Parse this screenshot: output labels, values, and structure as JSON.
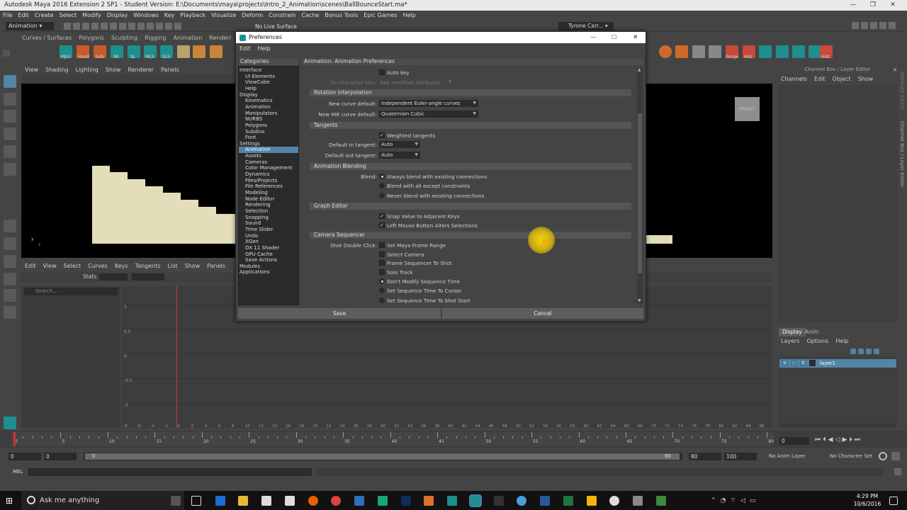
{
  "window": {
    "title": "Autodesk Maya 2016 Extension 2 SP1 - Student Version: E:\\Documents\\maya\\projects\\Intro_2_Animation\\scenes\\BallBounceStart.ma*",
    "minimize": "—",
    "restore": "❐",
    "close": "✕"
  },
  "menubar": [
    "File",
    "Edit",
    "Create",
    "Select",
    "Modify",
    "Display",
    "Windows",
    "Key",
    "Playback",
    "Visualize",
    "Deform",
    "Constrain",
    "Cache",
    "Bonus Tools",
    "Epic Games",
    "Help"
  ],
  "statusline": {
    "mode": "Animation",
    "live_surface": "No Live Surface",
    "user": "Tyrone Carr..."
  },
  "shelf": {
    "tabs": [
      "Curves / Surfaces",
      "Polygons",
      "Sculpting",
      "Rigging",
      "Animation",
      "Renderi"
    ],
    "buttons_left": [
      "MJUI",
      "Hand",
      "Sob",
      "SR",
      "SL",
      "MLS",
      "ELS"
    ],
    "buttons_right": [
      "Gorge",
      "Hist",
      "Hist"
    ]
  },
  "viewport": {
    "menu": [
      "View",
      "Shading",
      "Lighting",
      "Show",
      "Renderer",
      "Panels"
    ],
    "view_cube_label": "FRONT",
    "axis_y": "y",
    "axis_z": "z"
  },
  "graph_editor": {
    "menu": [
      "Edit",
      "View",
      "Select",
      "Curves",
      "Keys",
      "Tangents",
      "List",
      "Show",
      "Panels"
    ],
    "stats_label": "Stats",
    "search_placeholder": "Search...",
    "y_ticks": [
      "1",
      "0.5",
      "0",
      "-0.5",
      "-1"
    ],
    "x_ticks": [
      "-8",
      "-6",
      "-4",
      "-2",
      "0",
      "2",
      "4",
      "6",
      "8",
      "10",
      "12",
      "14",
      "16",
      "18",
      "20",
      "22",
      "24",
      "26",
      "28",
      "30",
      "32",
      "34",
      "36",
      "38",
      "40",
      "42",
      "44",
      "46",
      "48",
      "50",
      "52",
      "54",
      "56",
      "58",
      "60",
      "62",
      "64",
      "66",
      "68",
      "70",
      "72",
      "74",
      "76",
      "78",
      "80",
      "82",
      "84",
      "86"
    ]
  },
  "channel_box": {
    "header": "Channel Box / Layer Editor",
    "menu": [
      "Channels",
      "Edit",
      "Object",
      "Show"
    ],
    "side_tabs": [
      "Attribute Editor",
      "Channel Box / Layer Editor"
    ]
  },
  "layer_editor": {
    "tabs": [
      "Display",
      "Anim"
    ],
    "menu": [
      "Layers",
      "Options",
      "Help"
    ],
    "layer": {
      "visible": "V",
      "playback": "",
      "render": "R",
      "name": "layer1"
    }
  },
  "timeline": {
    "ruler_ticks": [
      "0",
      "5",
      "10",
      "15",
      "20",
      "25",
      "30",
      "35",
      "40",
      "45",
      "50",
      "55",
      "60",
      "65",
      "70",
      "75",
      "80"
    ],
    "current_frame": "0",
    "range_start": "0",
    "range_inner_start": "0",
    "range_slider_start": "0",
    "range_slider_end": "80",
    "range_inner_end": "80",
    "range_end": "100",
    "anim_layer": "No Anim Layer",
    "char_set": "No Character Set"
  },
  "mel": {
    "label": "MEL"
  },
  "taskbar": {
    "search_placeholder": "Ask me anything",
    "time": "4:29 PM",
    "date": "10/6/2016"
  },
  "preferences": {
    "title": "Preferences",
    "menu": [
      "Edit",
      "Help"
    ],
    "categories_header": "Categories",
    "panel_header": "Animation: Animation Preferences",
    "categories": [
      {
        "label": "Interface",
        "level": 0
      },
      {
        "label": "UI Elements",
        "level": 1
      },
      {
        "label": "ViewCube",
        "level": 1
      },
      {
        "label": "Help",
        "level": 1
      },
      {
        "label": "Display",
        "level": 0
      },
      {
        "label": "Kinematics",
        "level": 1
      },
      {
        "label": "Animation",
        "level": 1
      },
      {
        "label": "Manipulators",
        "level": 1
      },
      {
        "label": "NURBS",
        "level": 1
      },
      {
        "label": "Polygons",
        "level": 1
      },
      {
        "label": "Subdivs",
        "level": 1
      },
      {
        "label": "Font",
        "level": 1
      },
      {
        "label": "Settings",
        "level": 0
      },
      {
        "label": "Animation",
        "level": 1,
        "selected": true
      },
      {
        "label": "Assets",
        "level": 1
      },
      {
        "label": "Cameras",
        "level": 1
      },
      {
        "label": "Color Management",
        "level": 1
      },
      {
        "label": "Dynamics",
        "level": 1
      },
      {
        "label": "Files/Projects",
        "level": 1
      },
      {
        "label": "File References",
        "level": 1
      },
      {
        "label": "Modeling",
        "level": 1
      },
      {
        "label": "Node Editor",
        "level": 1
      },
      {
        "label": "Rendering",
        "level": 1
      },
      {
        "label": "Selection",
        "level": 1
      },
      {
        "label": "Snapping",
        "level": 1
      },
      {
        "label": "Sound",
        "level": 1
      },
      {
        "label": "Time Slider",
        "level": 1
      },
      {
        "label": "Undo",
        "level": 1
      },
      {
        "label": "XGen",
        "level": 1
      },
      {
        "label": "DX 11 Shader",
        "level": 1
      },
      {
        "label": "GPU Cache",
        "level": 1
      },
      {
        "label": "Save Actions",
        "level": 1
      },
      {
        "label": "Modules",
        "level": 0
      },
      {
        "label": "Applications",
        "level": 0
      }
    ],
    "auto_key": {
      "label": "Auto key",
      "checked": false
    },
    "on_character_sets": {
      "label": "On character sets:",
      "value": "Key modified attributes"
    },
    "sections": {
      "rotation": "Rotation Interpolation",
      "tangents": "Tangents",
      "blending": "Animation Blending",
      "graph_editor": "Graph Editor",
      "camera_sequencer": "Camera Sequencer"
    },
    "new_curve_default": {
      "label": "New curve default:",
      "value": "Independent Euler-angle curves"
    },
    "new_hik_curve_default": {
      "label": "New HIK curve default:",
      "value": "Quaternion Cubic"
    },
    "weighted_tangents": {
      "label": "Weighted tangents",
      "checked": true
    },
    "default_in_tangent": {
      "label": "Default in tangent:",
      "value": "Auto"
    },
    "default_out_tangent": {
      "label": "Default out tangent:",
      "value": "Auto"
    },
    "blend": {
      "label": "Blend:",
      "options": [
        "Always blend with existing connections",
        "Blend with all except constraints",
        "Never blend with existing connections"
      ],
      "selected": 0
    },
    "snap_value": {
      "label": "Snap Value to Adjacent Keys",
      "checked": true
    },
    "left_mouse": {
      "label": "Left Mouse Button Alters Selections",
      "checked": true
    },
    "shot_double_click": {
      "label": "Shot Double Click:",
      "checkboxes": [
        "Set Maya Frame Range",
        "Select Camera",
        "Frame Sequencer To Shot",
        "Solo Track"
      ],
      "radios": [
        "Don't Modify Sequence Time",
        "Set Sequence Time To Cursor",
        "Set Sequence Time To Shot Start"
      ],
      "radio_selected": 0
    },
    "save_button": "Save",
    "cancel_button": "Cancel"
  }
}
